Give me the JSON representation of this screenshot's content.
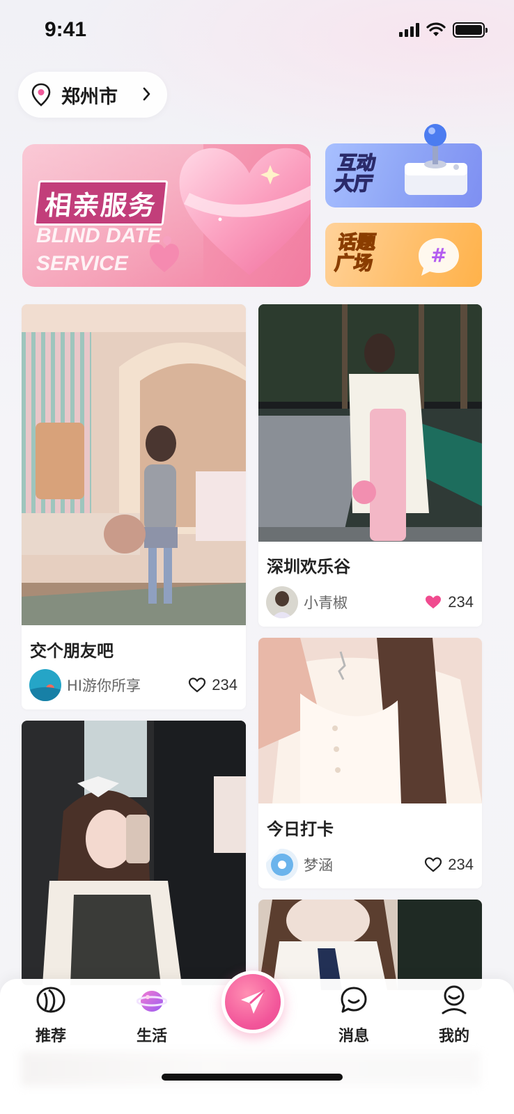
{
  "status_bar": {
    "time": "9:41"
  },
  "location": {
    "city": "郑州市"
  },
  "banners": {
    "main": {
      "title": "相亲服务",
      "subtitle_line1": "BLIND DATE",
      "subtitle_line2": "SERVICE"
    },
    "hall": {
      "line1": "互动",
      "line2": "大厅"
    },
    "topic": {
      "line1": "话题",
      "line2": "广场",
      "symbol": "#"
    }
  },
  "feed": [
    {
      "title": "交个朋友吧",
      "author": "HI游你所享",
      "likes": "234",
      "liked": false
    },
    {
      "title": "深圳欢乐谷",
      "author": "小青椒",
      "likes": "234",
      "liked": true
    },
    {
      "title": "今日打卡",
      "author": "梦涵",
      "likes": "234",
      "liked": false
    }
  ],
  "nav": {
    "items": [
      {
        "label": "推荐",
        "icon": "recommend-icon"
      },
      {
        "label": "生活",
        "icon": "life-icon"
      },
      {
        "label": "消息",
        "icon": "message-icon"
      },
      {
        "label": "我的",
        "icon": "profile-icon"
      }
    ],
    "post_icon": "paper-plane-icon"
  },
  "colors": {
    "accent": "#f2569a",
    "like_active": "#f04b8f"
  }
}
